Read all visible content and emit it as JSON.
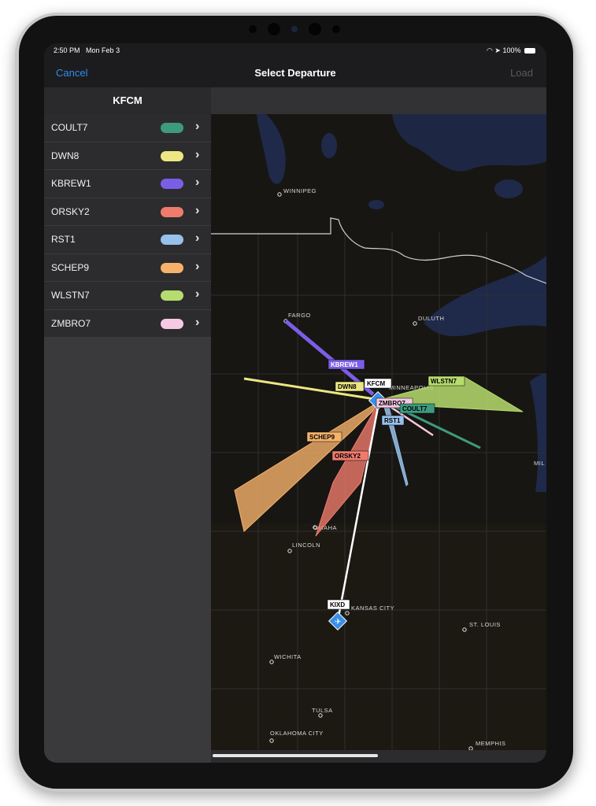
{
  "status_bar": {
    "time": "2:50 PM",
    "date": "Mon Feb 3",
    "battery": "100%"
  },
  "navbar": {
    "cancel": "Cancel",
    "title": "Select Departure",
    "load": "Load"
  },
  "sidebar": {
    "header": "KFCM",
    "items": [
      {
        "label": "COULT7",
        "color": "#3e9a7e"
      },
      {
        "label": "DWN8",
        "color": "#ece783"
      },
      {
        "label": "KBREW1",
        "color": "#7b5ee6"
      },
      {
        "label": "ORSKY2",
        "color": "#ef7b6d"
      },
      {
        "label": "RST1",
        "color": "#97c0ea"
      },
      {
        "label": "SCHEP9",
        "color": "#f6b26b"
      },
      {
        "label": "WLSTN7",
        "color": "#b7dc6e"
      },
      {
        "label": "ZMBRO7",
        "color": "#f6c9e3"
      }
    ]
  },
  "map": {
    "cities": [
      "WINNIPEG",
      "FARGO",
      "DULUTH",
      "MINNEAPOLIS",
      "OMAHA",
      "LINCOLN",
      "KANSAS CITY",
      "ST. LOUIS",
      "WICHITA",
      "TULSA",
      "OKLAHOMA CITY",
      "MEMPHIS",
      "MIL"
    ],
    "origin_airport": "KFCM",
    "destination_airport": "KIXD",
    "procedure_labels": [
      "KBREW1",
      "DWN8",
      "WLSTN7",
      "ZMBRO7",
      "COULT7",
      "RST1",
      "SCHEP9",
      "ORSKY2"
    ]
  }
}
